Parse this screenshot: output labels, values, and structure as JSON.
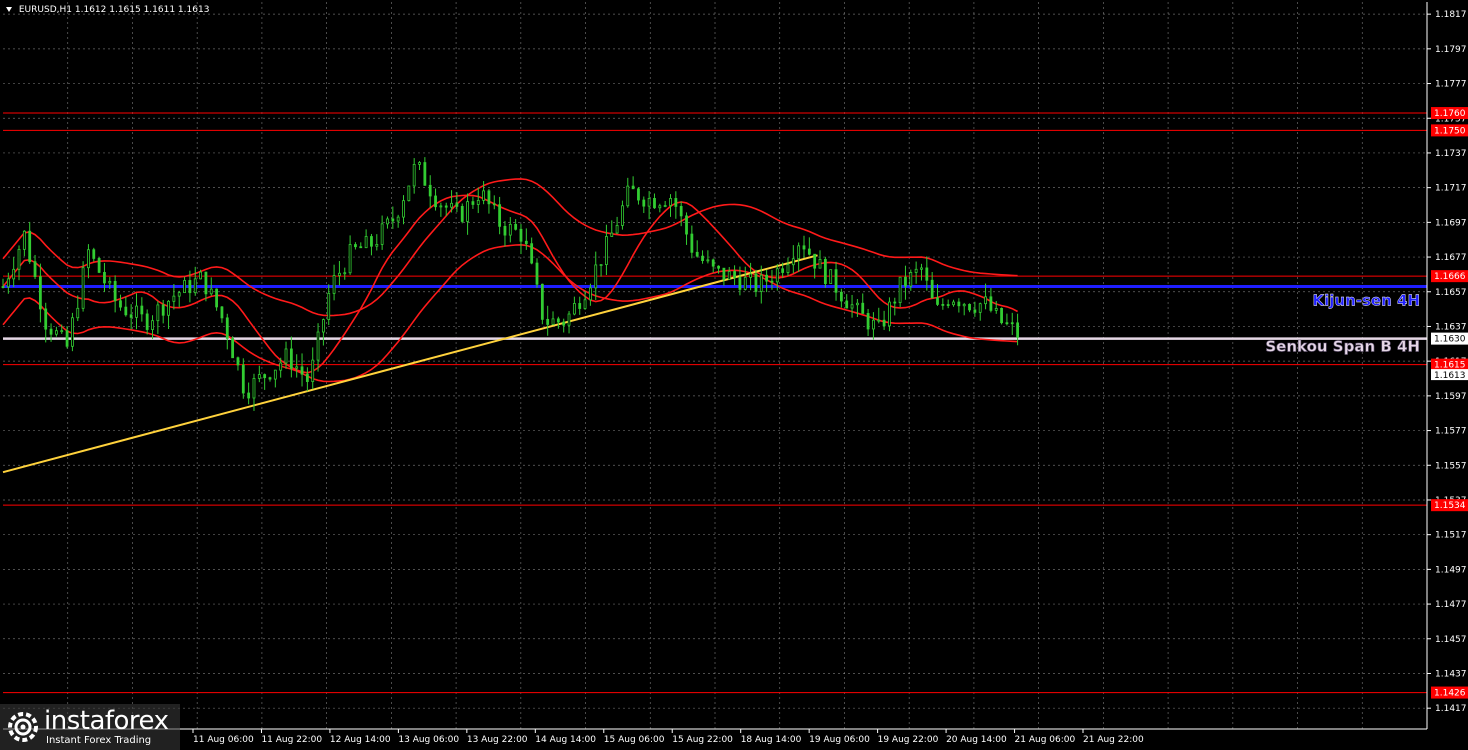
{
  "header": {
    "symbol": "EURUSD,H1",
    "ohlc": "1.1612 1.1615 1.1611 1.1613"
  },
  "watermark": {
    "brand": "instaforex",
    "tagline": "Instant Forex Trading"
  },
  "colors": {
    "background": "#000000",
    "grid": "#c0c0c0",
    "candle": "#32cd32",
    "ichimoku": "#ff1a1a",
    "trendline": "#ffd23c",
    "kijun": "#1e1eff",
    "senkou": "#e6d8e6",
    "level": "#ff0000"
  },
  "chart_data": {
    "type": "candlestick",
    "ylim": [
      1.1405,
      1.1824
    ],
    "y_ticks": [
      "1.1817",
      "1.1797",
      "1.1777",
      "1.1757",
      "1.1737",
      "1.1717",
      "1.1697",
      "1.1677",
      "1.1657",
      "1.1637",
      "1.1617",
      "1.1597",
      "1.1577",
      "1.1557",
      "1.1537",
      "1.1517",
      "1.1497",
      "1.1477",
      "1.1457",
      "1.1437",
      "1.1417"
    ],
    "x_ticks": [
      "11 Aug 06:00",
      "11 Aug 22:00",
      "12 Aug 14:00",
      "13 Aug 06:00",
      "13 Aug 22:00",
      "14 Aug 14:00",
      "15 Aug 06:00",
      "15 Aug 22:00",
      "18 Aug 14:00",
      "19 Aug 06:00",
      "19 Aug 22:00",
      "20 Aug 14:00",
      "21 Aug 06:00",
      "21 Aug 22:00"
    ],
    "levels": [
      {
        "value": 1.176,
        "label": "1.1760",
        "kind": "support-resistance"
      },
      {
        "value": 1.175,
        "label": "1.1750",
        "kind": "support-resistance"
      },
      {
        "value": 1.1666,
        "label": "1.1666",
        "kind": "support-resistance"
      },
      {
        "value": 1.1615,
        "label": "1.1615",
        "kind": "support-resistance"
      },
      {
        "value": 1.1534,
        "label": "1.1534",
        "kind": "support-resistance"
      },
      {
        "value": 1.1426,
        "label": "1.1426",
        "kind": "support-resistance"
      }
    ],
    "kijun_sen": {
      "value": 1.166,
      "label": "Kijun-sen 4H"
    },
    "senkou_span_b": {
      "value": 1.163,
      "label": "Senkou Span B 4H",
      "price_label": "1.1630"
    },
    "current_price": "1.1613",
    "trendline": {
      "start": [
        0,
        1.1553
      ],
      "end": [
        0.572,
        1.1678
      ]
    },
    "price_path": [
      [
        0.0,
        1.166
      ],
      [
        0.015,
        1.169
      ],
      [
        0.03,
        1.164
      ],
      [
        0.045,
        1.1625
      ],
      [
        0.06,
        1.168
      ],
      [
        0.08,
        1.165
      ],
      [
        0.1,
        1.164
      ],
      [
        0.12,
        1.1655
      ],
      [
        0.14,
        1.1665
      ],
      [
        0.155,
        1.164
      ],
      [
        0.17,
        1.16
      ],
      [
        0.185,
        1.161
      ],
      [
        0.2,
        1.162
      ],
      [
        0.215,
        1.1605
      ],
      [
        0.23,
        1.166
      ],
      [
        0.245,
        1.168
      ],
      [
        0.26,
        1.1685
      ],
      [
        0.275,
        1.17
      ],
      [
        0.29,
        1.173
      ],
      [
        0.305,
        1.171
      ],
      [
        0.32,
        1.17
      ],
      [
        0.335,
        1.1715
      ],
      [
        0.35,
        1.1695
      ],
      [
        0.365,
        1.169
      ],
      [
        0.38,
        1.164
      ],
      [
        0.395,
        1.164
      ],
      [
        0.41,
        1.166
      ],
      [
        0.425,
        1.1685
      ],
      [
        0.44,
        1.1715
      ],
      [
        0.455,
        1.171
      ],
      [
        0.47,
        1.1712
      ],
      [
        0.485,
        1.168
      ],
      [
        0.5,
        1.1668
      ],
      [
        0.515,
        1.1665
      ],
      [
        0.53,
        1.166
      ],
      [
        0.545,
        1.167
      ],
      [
        0.56,
        1.1688
      ],
      [
        0.57,
        1.1675
      ],
      [
        0.585,
        1.166
      ],
      [
        0.6,
        1.1645
      ],
      [
        0.615,
        1.1635
      ],
      [
        0.63,
        1.166
      ],
      [
        0.645,
        1.167
      ],
      [
        0.655,
        1.1645
      ],
      [
        0.665,
        1.1655
      ],
      [
        0.68,
        1.165
      ],
      [
        0.69,
        1.165
      ],
      [
        0.7,
        1.164
      ],
      [
        0.71,
        1.1635
      ],
      [
        0.715,
        1.163
      ]
    ]
  }
}
